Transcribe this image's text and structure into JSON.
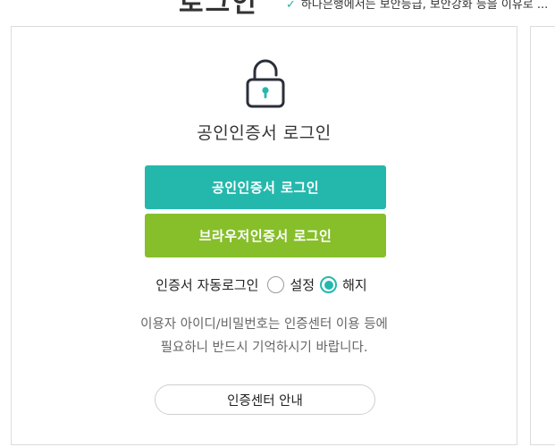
{
  "header": {
    "title": "로그인",
    "notice": "하나은행에서는 보안등급, 보안강화 등을 이유로 ..."
  },
  "card": {
    "title": "공인인증서 로그인",
    "cert_login_button": "공인인증서 로그인",
    "browser_cert_login_button": "브라우저인증서 로그인",
    "auto_login": {
      "label": "인증서 자동로그인",
      "options": [
        "설정",
        "해지"
      ],
      "selected": "해지"
    },
    "note_line1": "이용자 아이디/비밀번호는 인증센터 이용 등에",
    "note_line2": "필요하니 반드시 기억하시기 바랍니다.",
    "guide_button": "인증센터 안내"
  },
  "colors": {
    "teal": "#24b8ad",
    "green": "#86bf2a",
    "lock_stroke": "#2b2f3a"
  },
  "icons": [
    "check-icon",
    "lock-icon"
  ]
}
